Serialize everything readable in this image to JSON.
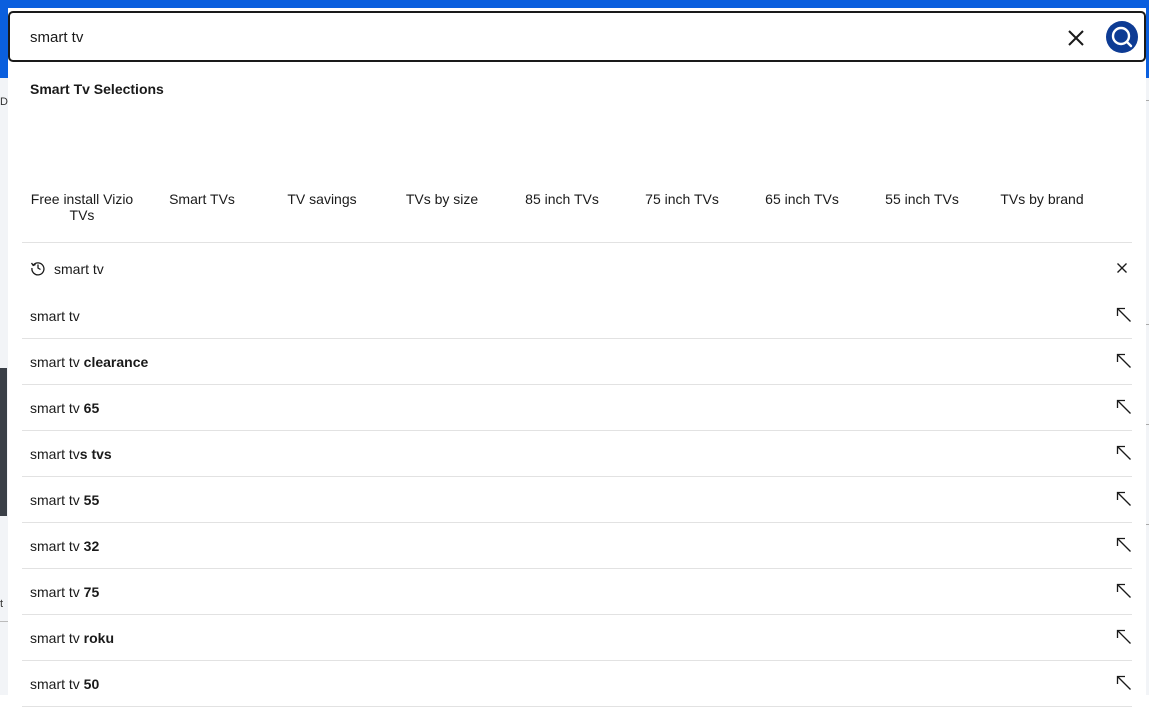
{
  "search": {
    "value": "smart tv",
    "placeholder": ""
  },
  "section": {
    "title": "Smart Tv Selections"
  },
  "tiles": [
    {
      "label": "Free install Vizio TVs"
    },
    {
      "label": "Smart TVs"
    },
    {
      "label": "TV savings"
    },
    {
      "label": "TVs by size"
    },
    {
      "label": "85 inch TVs"
    },
    {
      "label": "75 inch TVs"
    },
    {
      "label": "65 inch TVs"
    },
    {
      "label": "55 inch TVs"
    },
    {
      "label": "TVs by brand"
    }
  ],
  "recent": {
    "label": "smart tv"
  },
  "suggestions": [
    {
      "prefix": "smart tv",
      "suffix": ""
    },
    {
      "prefix": "smart tv ",
      "suffix": "clearance"
    },
    {
      "prefix": "smart tv ",
      "suffix": "65"
    },
    {
      "prefix": "smart tv",
      "suffix": "s tvs"
    },
    {
      "prefix": "smart tv ",
      "suffix": "55"
    },
    {
      "prefix": "smart tv ",
      "suffix": "32"
    },
    {
      "prefix": "smart tv ",
      "suffix": "75"
    },
    {
      "prefix": "smart tv ",
      "suffix": "roku"
    },
    {
      "prefix": "smart tv ",
      "suffix": "50"
    }
  ],
  "icons": {
    "clear": "close-icon",
    "search": "search-icon",
    "history": "history-icon",
    "remove": "close-icon",
    "fill": "arrow-up-left-icon"
  },
  "colors": {
    "header": "#0a5fde",
    "search_button": "#0d3b94",
    "text": "#1a1a1a",
    "divider": "#e2e2e2"
  }
}
